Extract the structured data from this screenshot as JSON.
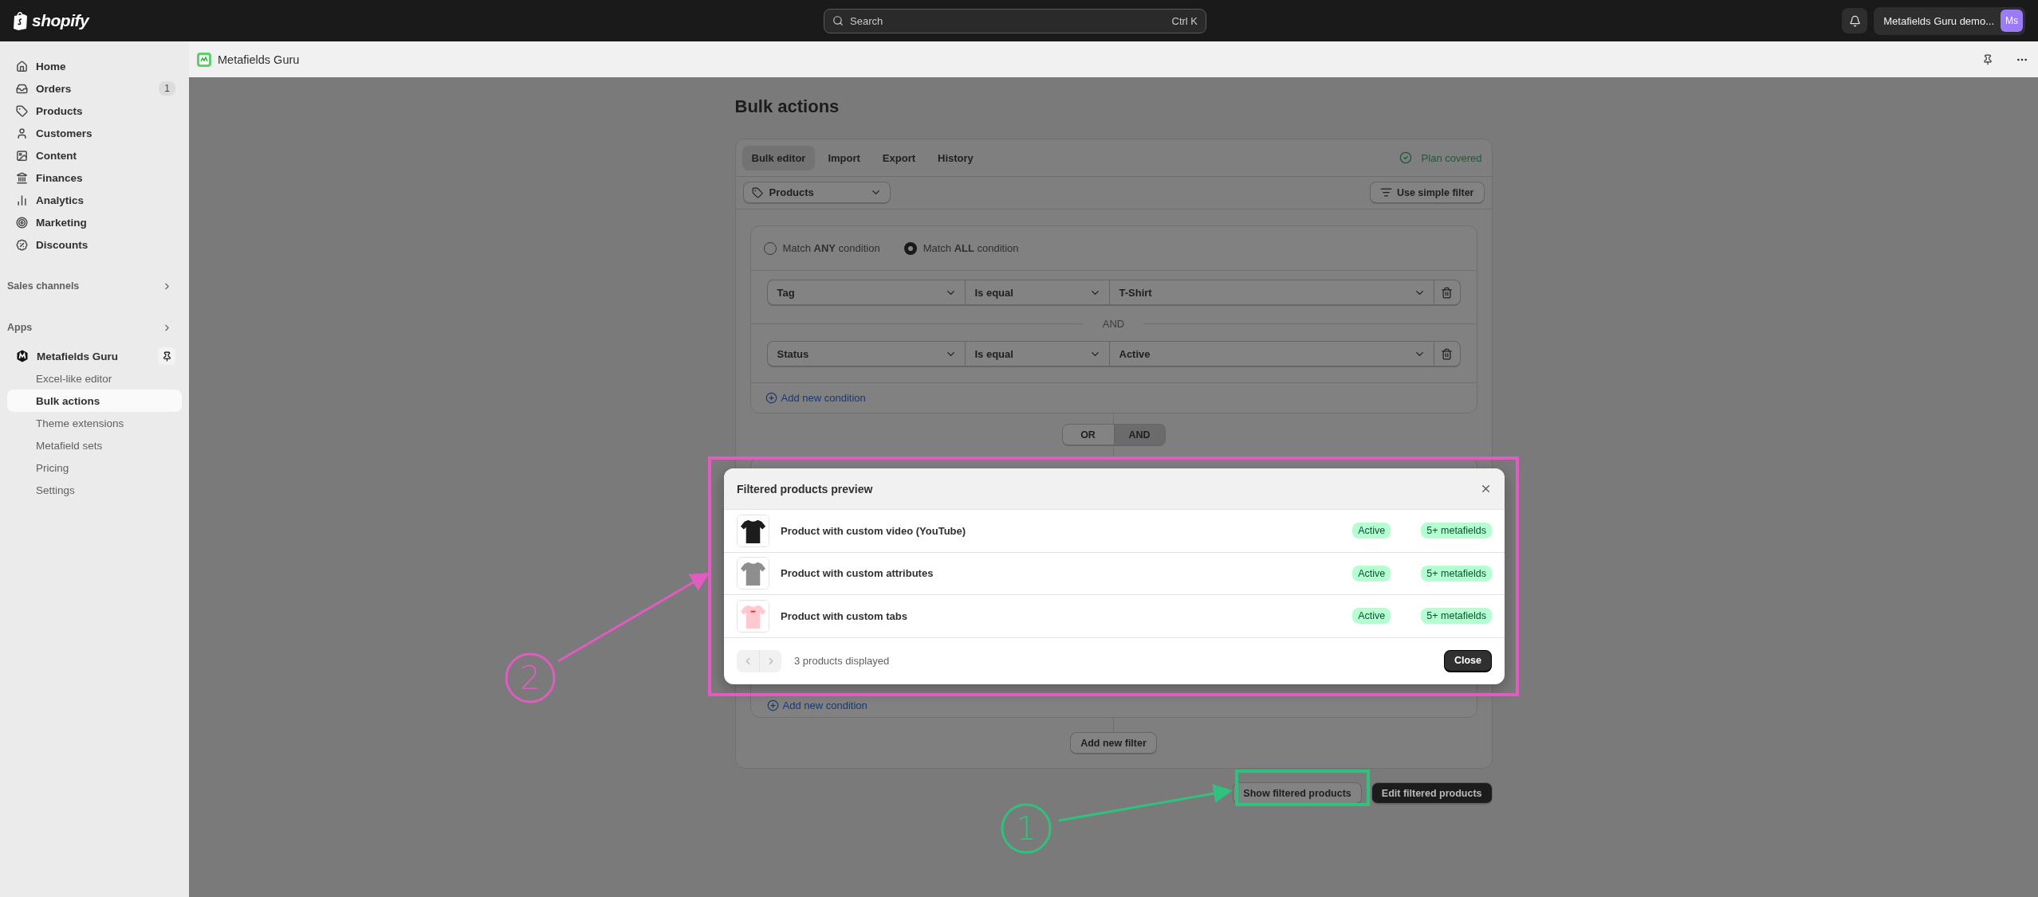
{
  "topbar": {
    "logo": "shopify",
    "search": {
      "placeholder": "Search",
      "shortcut": "Ctrl K"
    },
    "account": {
      "name": "Metafields Guru demo...",
      "initials": "Ms"
    }
  },
  "sidebar": {
    "nav": [
      {
        "label": "Home",
        "selected": false
      },
      {
        "label": "Orders",
        "badge": "1",
        "selected": false
      },
      {
        "label": "Products",
        "selected": false
      },
      {
        "label": "Customers",
        "selected": false
      },
      {
        "label": "Content",
        "selected": false
      },
      {
        "label": "Finances",
        "selected": false
      },
      {
        "label": "Analytics",
        "selected": false
      },
      {
        "label": "Marketing",
        "selected": false
      },
      {
        "label": "Discounts",
        "selected": false
      }
    ],
    "sections": [
      "Sales channels",
      "Apps"
    ],
    "app": {
      "name": "Metafields Guru",
      "items": [
        {
          "label": "Excel-like editor",
          "selected": false
        },
        {
          "label": "Bulk actions",
          "selected": true
        },
        {
          "label": "Theme extensions",
          "selected": false
        },
        {
          "label": "Metafield sets",
          "selected": false
        },
        {
          "label": "Pricing",
          "selected": false
        },
        {
          "label": "Settings",
          "selected": false
        }
      ]
    }
  },
  "app_header": {
    "title": "Metafields Guru"
  },
  "page": {
    "title": "Bulk actions",
    "tabs": [
      {
        "label": "Bulk editor",
        "selected": true
      },
      {
        "label": "Import",
        "selected": false
      },
      {
        "label": "Export",
        "selected": false
      },
      {
        "label": "History",
        "selected": false
      }
    ],
    "plan_status": "Plan covered",
    "resource_select": "Products",
    "simple_filter_button": "Use simple filter",
    "match_options": [
      {
        "label": "Match **ANY** condition",
        "selected": false
      },
      {
        "label": "Match **ALL** condition",
        "selected": true
      }
    ],
    "conditions": [
      {
        "field": "Tag",
        "operator": "Is equal",
        "value": "T-Shirt"
      },
      {
        "field": "Status",
        "operator": "Is equal",
        "value": "Active"
      }
    ],
    "joiner": "AND",
    "add_condition": "Add new condition",
    "group_toggle": [
      {
        "label": "OR",
        "selected": false
      },
      {
        "label": "AND",
        "selected": true
      }
    ],
    "add_condition_2": "Add new condition",
    "add_filter": "Add new filter",
    "actions": [
      {
        "label": "Show filtered products",
        "kind": "secondary"
      },
      {
        "label": "Edit filtered products",
        "kind": "primary"
      }
    ]
  },
  "modal": {
    "title": "Filtered products preview",
    "products": [
      {
        "name": "Product with custom video (YouTube)",
        "status": "Active",
        "metafields": "5+ metafields"
      },
      {
        "name": "Product with custom attributes",
        "status": "Active",
        "metafields": "5+ metafields"
      },
      {
        "name": "Product with custom tabs",
        "status": "Active",
        "metafields": "5+ metafields"
      }
    ],
    "count": "3 products displayed",
    "close_button": "Close"
  },
  "annotations": [
    {
      "label": "1",
      "color": "#2ec27e"
    },
    {
      "label": "2",
      "color": "#e05cc0"
    }
  ]
}
